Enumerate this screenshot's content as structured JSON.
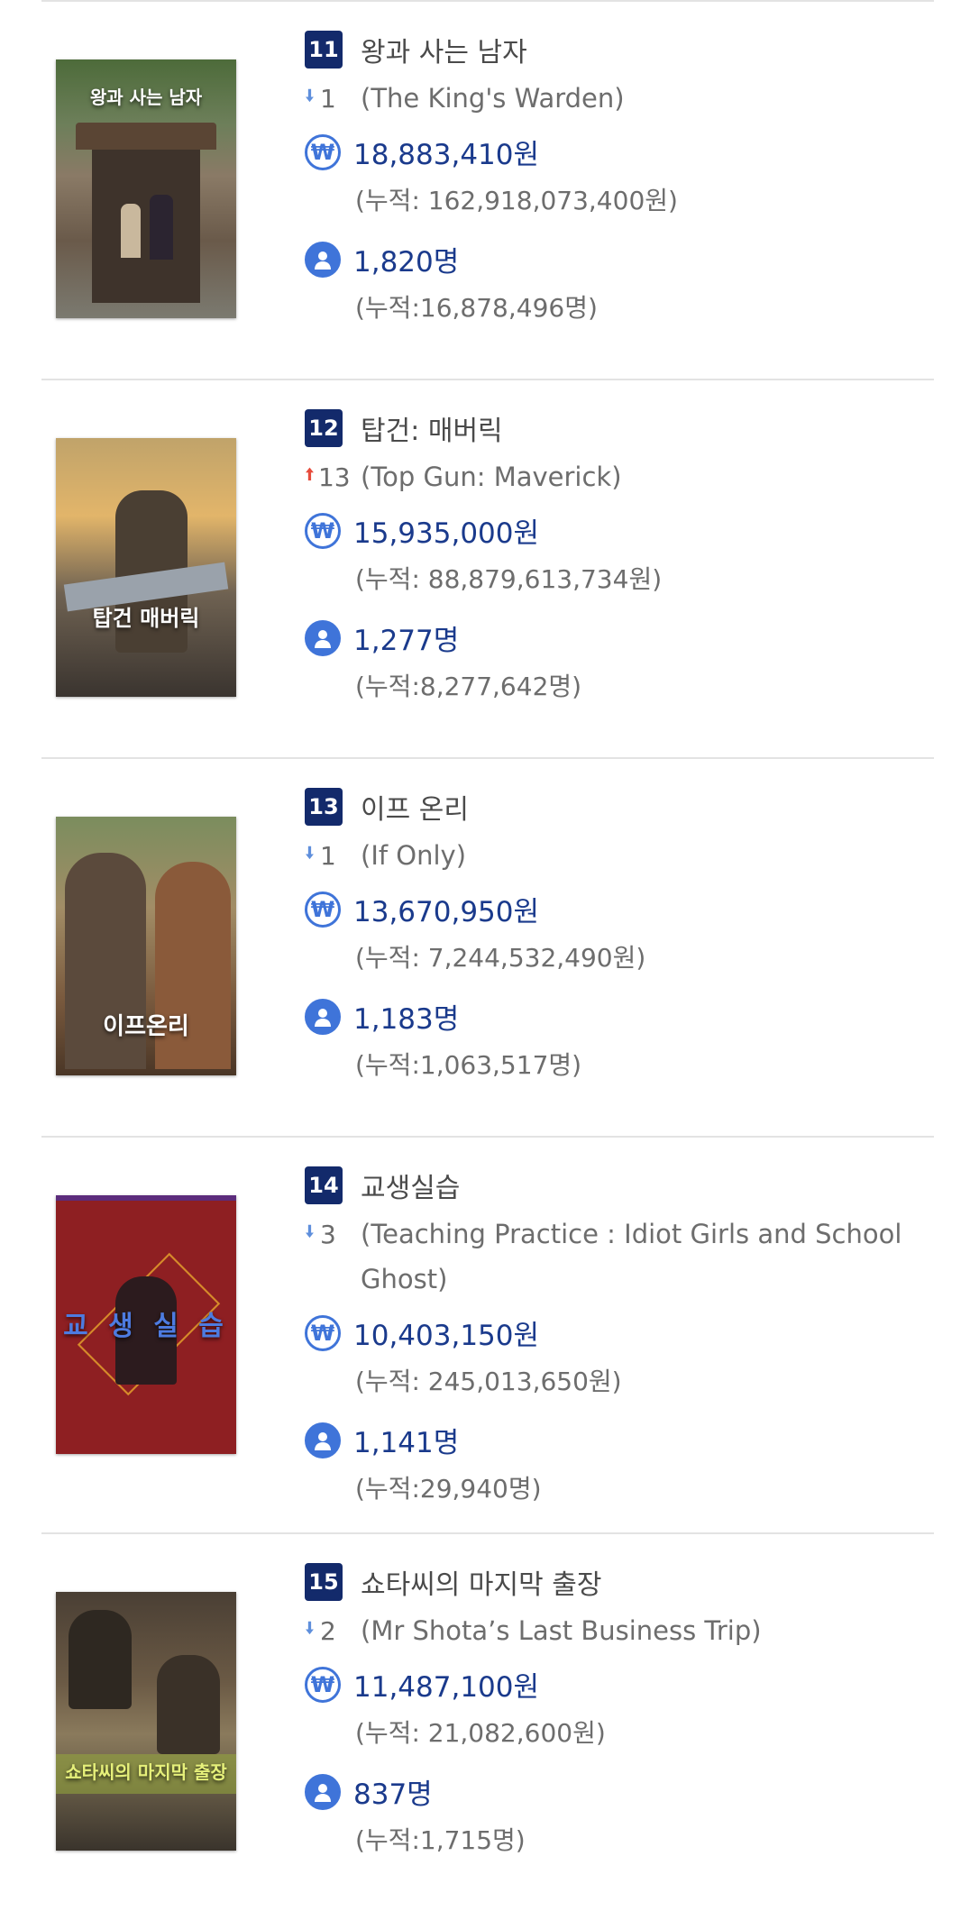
{
  "colors": {
    "rank_badge": "#132a6b",
    "accent": "#3f74d9",
    "down": "#5f8fdc",
    "up": "#e74c3c"
  },
  "movies": [
    {
      "rank": "11",
      "title_kr": "왕과 사는 남자",
      "change_dir": "down",
      "change": "1",
      "title_en": "(The King's Warden)",
      "revenue": "18,883,410원",
      "revenue_cum": "(누적: 162,918,073,400원)",
      "audience": "1,820명",
      "audience_cum": "(누적:16,878,496명)",
      "poster_text": "왕과 사는 남자"
    },
    {
      "rank": "12",
      "title_kr": "탑건: 매버릭",
      "change_dir": "up",
      "change": "13",
      "title_en": "(Top Gun: Maverick)",
      "revenue": "15,935,000원",
      "revenue_cum": "(누적: 88,879,613,734원)",
      "audience": "1,277명",
      "audience_cum": "(누적:8,277,642명)",
      "poster_text": "탑건 매버릭"
    },
    {
      "rank": "13",
      "title_kr": "이프 온리",
      "change_dir": "down",
      "change": "1",
      "title_en": "(If Only)",
      "revenue": "13,670,950원",
      "revenue_cum": "(누적: 7,244,532,490원)",
      "audience": "1,183명",
      "audience_cum": "(누적:1,063,517명)",
      "poster_text": "이프온리"
    },
    {
      "rank": "14",
      "title_kr": "교생실습",
      "change_dir": "down",
      "change": "3",
      "title_en": "(Teaching Practice : Idiot Girls and School Ghost)",
      "revenue": "10,403,150원",
      "revenue_cum": "(누적: 245,013,650원)",
      "audience": "1,141명",
      "audience_cum": "(누적:29,940명)",
      "poster_text": "교 생 실 습"
    },
    {
      "rank": "15",
      "title_kr": "쇼타씨의 마지막 출장",
      "change_dir": "down",
      "change": "2",
      "title_en": "(Mr Shota’s Last Business Trip)",
      "revenue": "11,487,100원",
      "revenue_cum": "(누적: 21,082,600원)",
      "audience": "837명",
      "audience_cum": "(누적:1,715명)",
      "poster_text": "쇼타씨의 마지막 출장"
    }
  ]
}
